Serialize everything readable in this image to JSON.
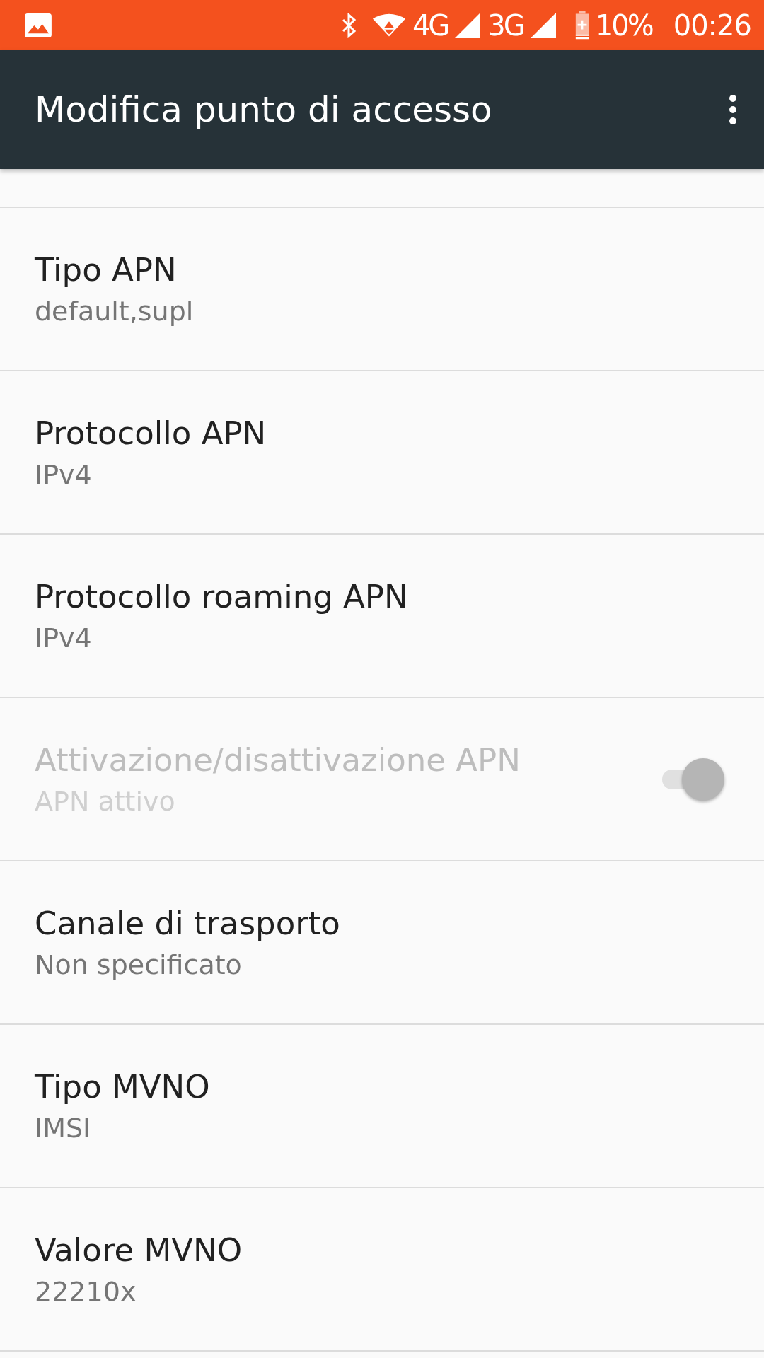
{
  "status_bar": {
    "network_1": "4G",
    "network_2": "3G",
    "battery": "10%",
    "time": "00:26"
  },
  "toolbar": {
    "title": "Modifica punto di accesso"
  },
  "settings": [
    {
      "kind": "text",
      "title": "Tipo APN",
      "summary": "default,supl",
      "disabled": false
    },
    {
      "kind": "text",
      "title": "Protocollo APN",
      "summary": "IPv4",
      "disabled": false
    },
    {
      "kind": "text",
      "title": "Protocollo roaming APN",
      "summary": "IPv4",
      "disabled": false
    },
    {
      "kind": "switch",
      "title": "Attivazione/disattivazione APN",
      "summary": "APN attivo",
      "disabled": true,
      "on": true
    },
    {
      "kind": "text",
      "title": "Canale di trasporto",
      "summary": "Non specificato",
      "disabled": false
    },
    {
      "kind": "text",
      "title": "Tipo MVNO",
      "summary": "IMSI",
      "disabled": false
    },
    {
      "kind": "text",
      "title": "Valore MVNO",
      "summary": "22210x",
      "disabled": false
    }
  ]
}
